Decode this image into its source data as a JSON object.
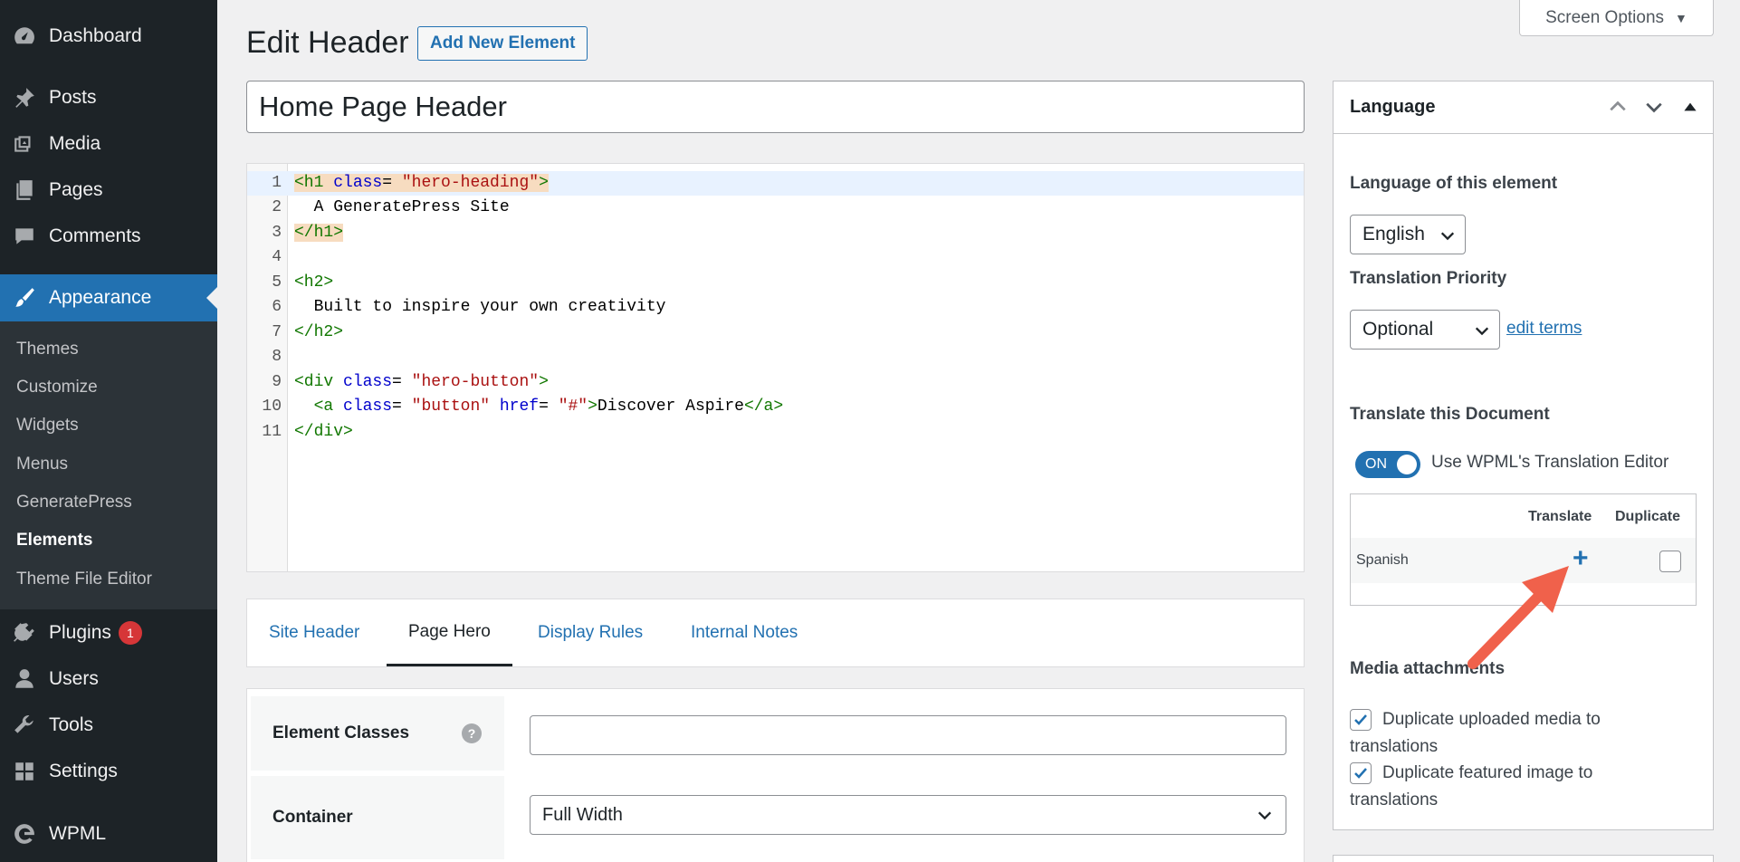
{
  "sidebar": {
    "items": [
      {
        "label": "Dashboard",
        "icon": "dashboard-icon"
      },
      {
        "label": "Posts",
        "icon": "pin-icon"
      },
      {
        "label": "Media",
        "icon": "media-icon"
      },
      {
        "label": "Pages",
        "icon": "pages-icon"
      },
      {
        "label": "Comments",
        "icon": "comment-icon"
      },
      {
        "label": "Appearance",
        "icon": "brush-icon"
      },
      {
        "label": "Plugins",
        "icon": "plugin-icon",
        "badge": "1"
      },
      {
        "label": "Users",
        "icon": "user-icon"
      },
      {
        "label": "Tools",
        "icon": "wrench-icon"
      },
      {
        "label": "Settings",
        "icon": "settings-icon"
      },
      {
        "label": "WPML",
        "icon": "wpml-icon"
      }
    ],
    "submenu": [
      "Themes",
      "Customize",
      "Widgets",
      "Menus",
      "GeneratePress",
      "Elements",
      "Theme File Editor"
    ]
  },
  "header": {
    "title": "Edit Header",
    "add_new": "Add New Element",
    "screen_options": "Screen Options"
  },
  "post_title": "Home Page Header",
  "editor": {
    "line_numbers": [
      "1",
      "2",
      "3",
      "4",
      "5",
      "6",
      "7",
      "8",
      "9",
      "10",
      "11"
    ],
    "l1_open": "<h1 ",
    "l1_attr": "class",
    "l1_eq": "= ",
    "l1_str": "\"hero-heading\"",
    "l1_close": ">",
    "l2": "  A GeneratePress Site",
    "l3": "</h1>",
    "l5": "<h2>",
    "l6": "  Built to inspire your own creativity",
    "l7": "</h2>",
    "l9_open": "<div ",
    "l9_attr": "class",
    "l9_eq": "= ",
    "l9_str": "\"hero-button\"",
    "l9_close": ">",
    "l10_indent": "  ",
    "l10_open": "<a ",
    "l10_attr1": "class",
    "l10_eq1": "= ",
    "l10_str1": "\"button\"",
    "l10_sp": " ",
    "l10_attr2": "href",
    "l10_eq2": "= ",
    "l10_str2": "\"#\"",
    "l10_gt": ">",
    "l10_text": "Discover Aspire",
    "l10_end": "</a>",
    "l11": "</div>"
  },
  "tabs": [
    "Site Header",
    "Page Hero",
    "Display Rules",
    "Internal Notes"
  ],
  "form": {
    "element_classes_label": "Element Classes",
    "help": "?",
    "element_classes_value": "",
    "container_label": "Container",
    "container_value": "Full Width"
  },
  "language_box": {
    "title": "Language",
    "language_label": "Language of this element",
    "language_value": "English",
    "priority_label": "Translation Priority",
    "priority_value": "Optional",
    "edit_terms": "edit terms",
    "translate_doc_label": "Translate this Document",
    "toggle_state": "ON",
    "toggle_text": "Use WPML's Translation Editor",
    "col_translate": "Translate",
    "col_duplicate": "Duplicate",
    "row_language": "Spanish",
    "plus": "+",
    "media_label": "Media attachments",
    "dup_media": "Duplicate uploaded media to translations",
    "dup_featured": "Duplicate featured image to translations"
  },
  "colors": {
    "sidebar_bg": "#1d2327",
    "accent": "#2271b1",
    "arrow": "#f0614b",
    "badge": "#d63638"
  }
}
